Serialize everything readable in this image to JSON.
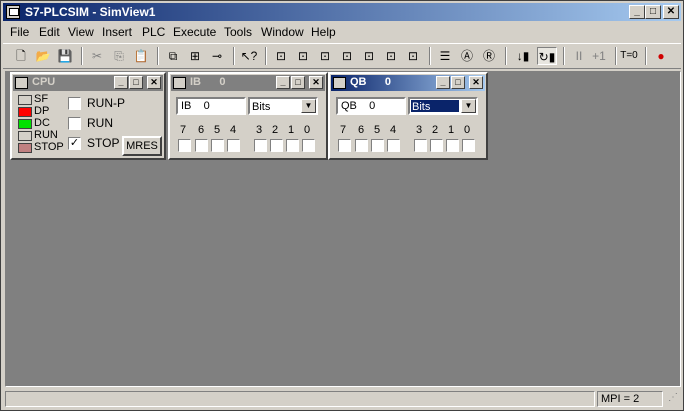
{
  "window": {
    "title": "S7-PLCSIM - SimView1"
  },
  "menu": [
    "File",
    "Edit",
    "View",
    "Insert",
    "PLC",
    "Execute",
    "Tools",
    "Window",
    "Help"
  ],
  "toolbar": {
    "step_label": "+1",
    "pause_label": "II",
    "timer_label": "T=0"
  },
  "cpu": {
    "title": "CPU",
    "leds": [
      {
        "label": "SF",
        "color": "#d4d0c8"
      },
      {
        "label": "DP",
        "color": "#ff0000"
      },
      {
        "label": "DC",
        "color": "#00e000"
      },
      {
        "label": "RUN",
        "color": "#d4d0c8"
      },
      {
        "label": "STOP",
        "color": "#c08080"
      }
    ],
    "modes": [
      {
        "label": "RUN-P",
        "checked": ""
      },
      {
        "label": "RUN",
        "checked": ""
      },
      {
        "label": "STOP",
        "checked": "✓"
      }
    ],
    "mres_label": "MRES"
  },
  "ib": {
    "title": "IB      0",
    "address": "IB    0",
    "format": "Bits",
    "bits": [
      "7",
      "6",
      "5",
      "4",
      "3",
      "2",
      "1",
      "0"
    ]
  },
  "qb": {
    "title": "QB      0",
    "address": "QB    0",
    "format": "Bits",
    "bits": [
      "7",
      "6",
      "5",
      "4",
      "3",
      "2",
      "1",
      "0"
    ]
  },
  "status": {
    "mpi": "MPI = 2"
  }
}
